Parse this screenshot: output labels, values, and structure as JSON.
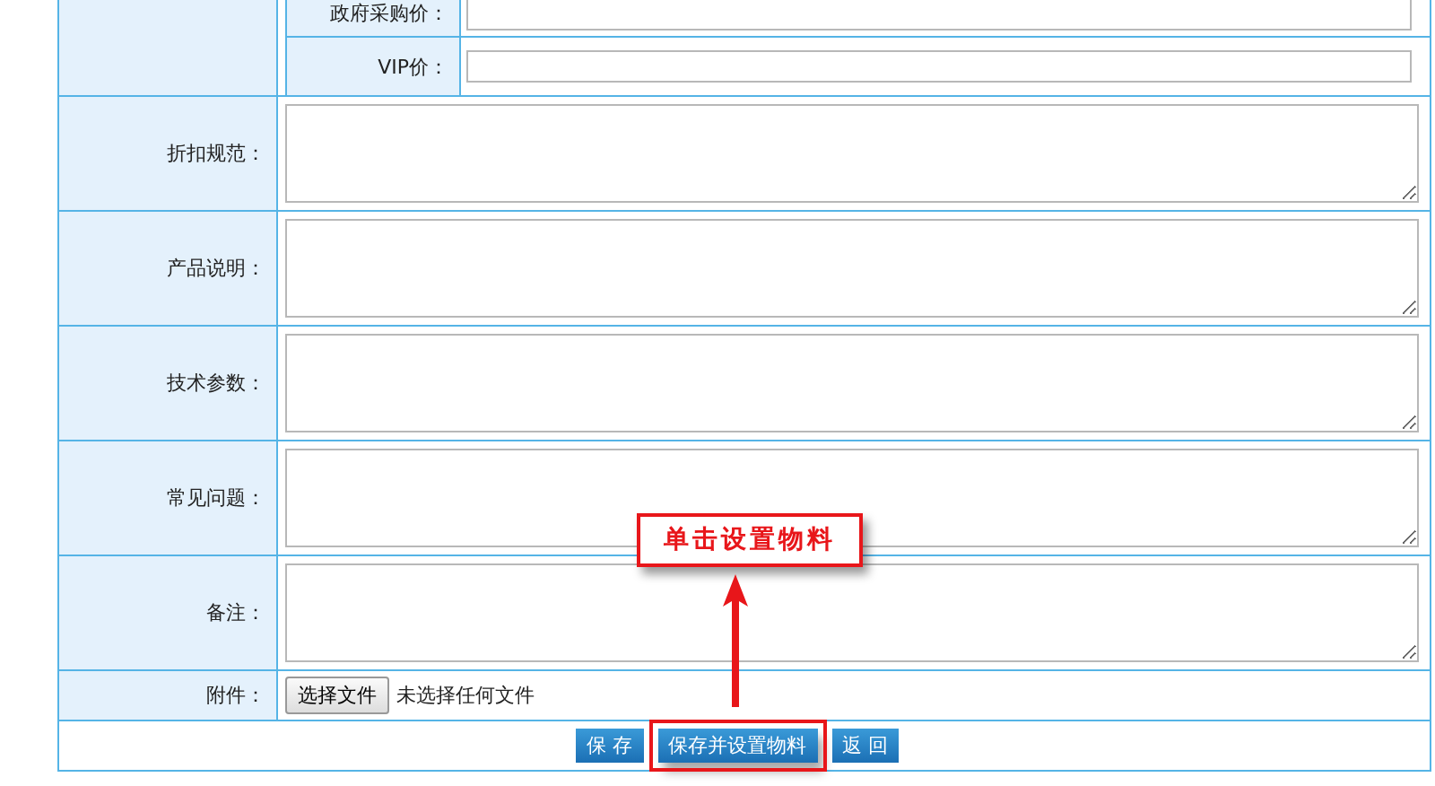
{
  "price_rows": [
    {
      "label": "政府采购价："
    },
    {
      "label": "VIP价："
    }
  ],
  "text_fields": [
    {
      "label": "折扣规范："
    },
    {
      "label": "产品说明："
    },
    {
      "label": "技术参数："
    },
    {
      "label": "常见问题："
    },
    {
      "label": "备注："
    }
  ],
  "attachment": {
    "label": "附件：",
    "button": "选择文件",
    "status": "未选择任何文件"
  },
  "buttons": [
    {
      "label": "保 存",
      "highlighted": false
    },
    {
      "label": "保存并设置物料",
      "highlighted": true
    },
    {
      "label": "返 回",
      "highlighted": false
    }
  ],
  "callout": {
    "text": "单击设置物料"
  }
}
